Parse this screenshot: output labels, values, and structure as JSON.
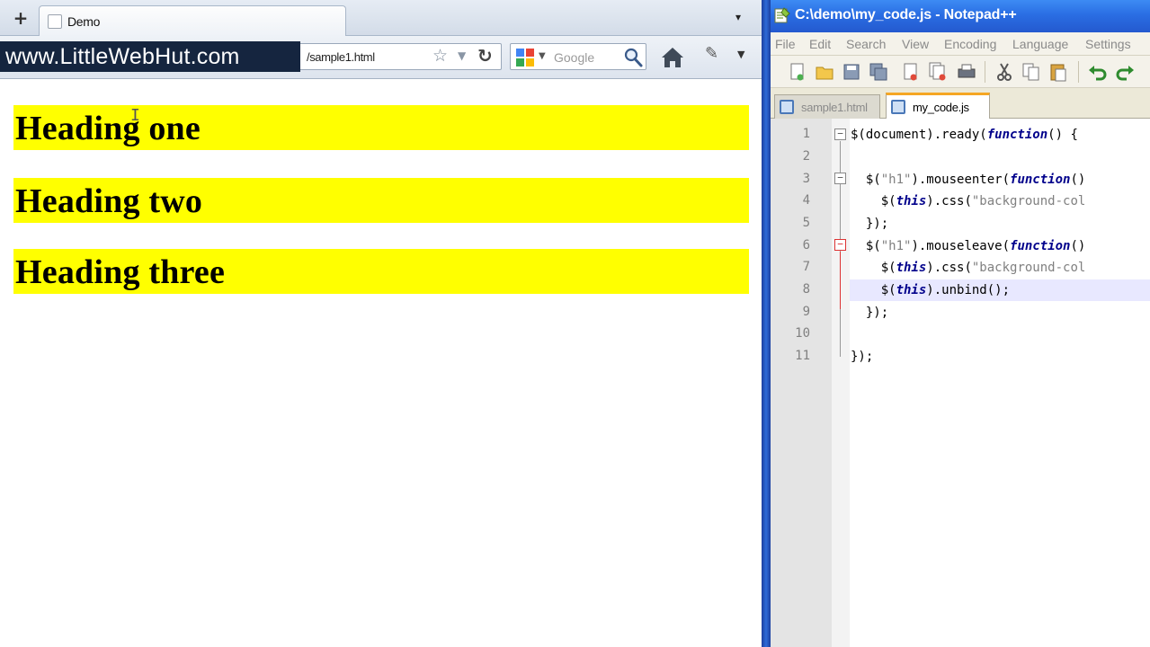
{
  "watermark": "www.LittleWebHut.com",
  "browser": {
    "new_tab_glyph": "+",
    "tab_label": "Demo",
    "tab_list_glyph": "▾",
    "url": "/sample1.html",
    "search_placeholder": "Google",
    "icons": [
      "new-tab-icon",
      "favicon-icon",
      "star-icon",
      "reload-icon",
      "google-icon",
      "magnifier-icon",
      "home-icon",
      "bookmarks-icon"
    ]
  },
  "page": {
    "headings": [
      "Heading one",
      "Heading two",
      "Heading three"
    ],
    "heading_background": "#ffff00"
  },
  "notepad": {
    "title": "C:\\demo\\my_code.js - Notepad++",
    "menu": [
      "File",
      "Edit",
      "Search",
      "View",
      "Encoding",
      "Language",
      "Settings"
    ],
    "tabs": [
      {
        "label": "sample1.html",
        "active": false
      },
      {
        "label": "my_code.js",
        "active": true
      }
    ],
    "line_numbers": [
      "1",
      "2",
      "3",
      "4",
      "5",
      "6",
      "7",
      "8",
      "9",
      "10",
      "11"
    ],
    "current_line": 8,
    "colors": {
      "keyword": "#00008b",
      "string": "#808080",
      "titlebar": "#2a6ee3"
    },
    "code": {
      "l1": [
        "$(document).ready(",
        "function",
        "() {"
      ],
      "l3": [
        "  $(",
        "\"h1\"",
        ").mouseenter(",
        "function",
        "()"
      ],
      "l4": [
        "    $(",
        "this",
        ").css(",
        "\"background-col"
      ],
      "l5": [
        "  });"
      ],
      "l6": [
        "  $(",
        "\"h1\"",
        ").mouseleave(",
        "function",
        "()"
      ],
      "l7": [
        "    $(",
        "this",
        ").css(",
        "\"background-col"
      ],
      "l8": [
        "    $(",
        "this",
        ").unbind();"
      ],
      "l9": [
        "  });"
      ],
      "l11": [
        "});"
      ]
    }
  }
}
